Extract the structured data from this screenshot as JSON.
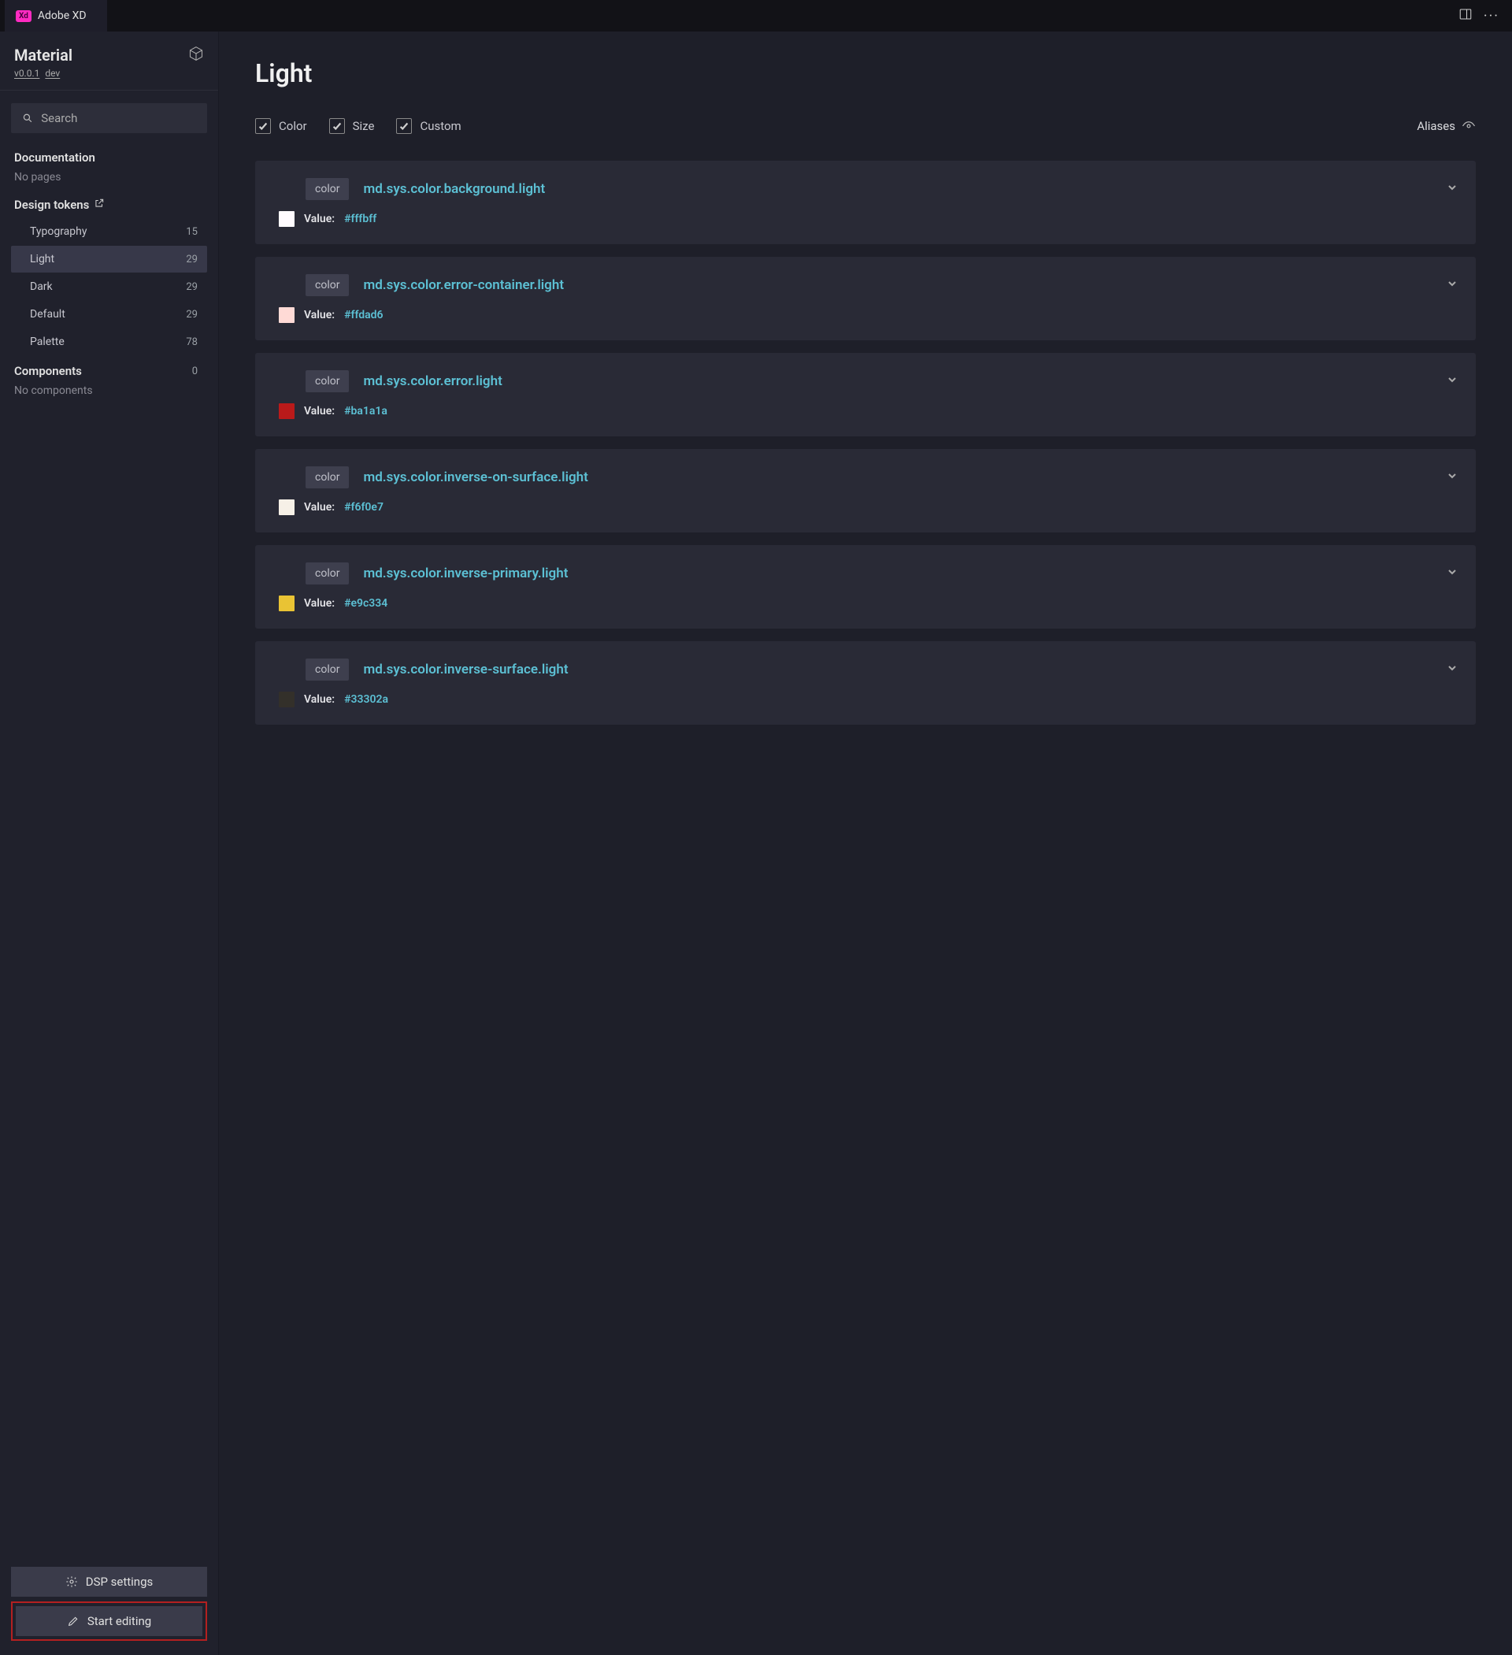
{
  "titlebar": {
    "tab_label": "Adobe XD",
    "xd_badge": "Xd"
  },
  "project": {
    "name": "Material",
    "version": "v0.0.1",
    "branch": "dev"
  },
  "search": {
    "placeholder": "Search"
  },
  "sections": {
    "documentation_label": "Documentation",
    "documentation_empty": "No pages",
    "design_tokens_label": "Design tokens",
    "components_label": "Components",
    "components_count": "0",
    "components_empty": "No components"
  },
  "nav": [
    {
      "label": "Typography",
      "count": "15",
      "active": false
    },
    {
      "label": "Light",
      "count": "29",
      "active": true
    },
    {
      "label": "Dark",
      "count": "29",
      "active": false
    },
    {
      "label": "Default",
      "count": "29",
      "active": false
    },
    {
      "label": "Palette",
      "count": "78",
      "active": false
    }
  ],
  "footer": {
    "dsp_settings": "DSP settings",
    "start_editing": "Start editing"
  },
  "main": {
    "title": "Light",
    "filters": {
      "color": "Color",
      "size": "Size",
      "custom": "Custom"
    },
    "aliases_label": "Aliases",
    "value_label": "Value: ",
    "tag_label": "color",
    "tokens": [
      {
        "name": "md.sys.color.background.light",
        "hex": "#fffbff",
        "swatch": "#fffbff"
      },
      {
        "name": "md.sys.color.error-container.light",
        "hex": "#ffdad6",
        "swatch": "#ffdad6"
      },
      {
        "name": "md.sys.color.error.light",
        "hex": "#ba1a1a",
        "swatch": "#ba1a1a"
      },
      {
        "name": "md.sys.color.inverse-on-surface.light",
        "hex": "#f6f0e7",
        "swatch": "#f6f0e7"
      },
      {
        "name": "md.sys.color.inverse-primary.light",
        "hex": "#e9c334",
        "swatch": "#e9c334"
      },
      {
        "name": "md.sys.color.inverse-surface.light",
        "hex": "#33302a",
        "swatch": "#33302a"
      }
    ]
  }
}
